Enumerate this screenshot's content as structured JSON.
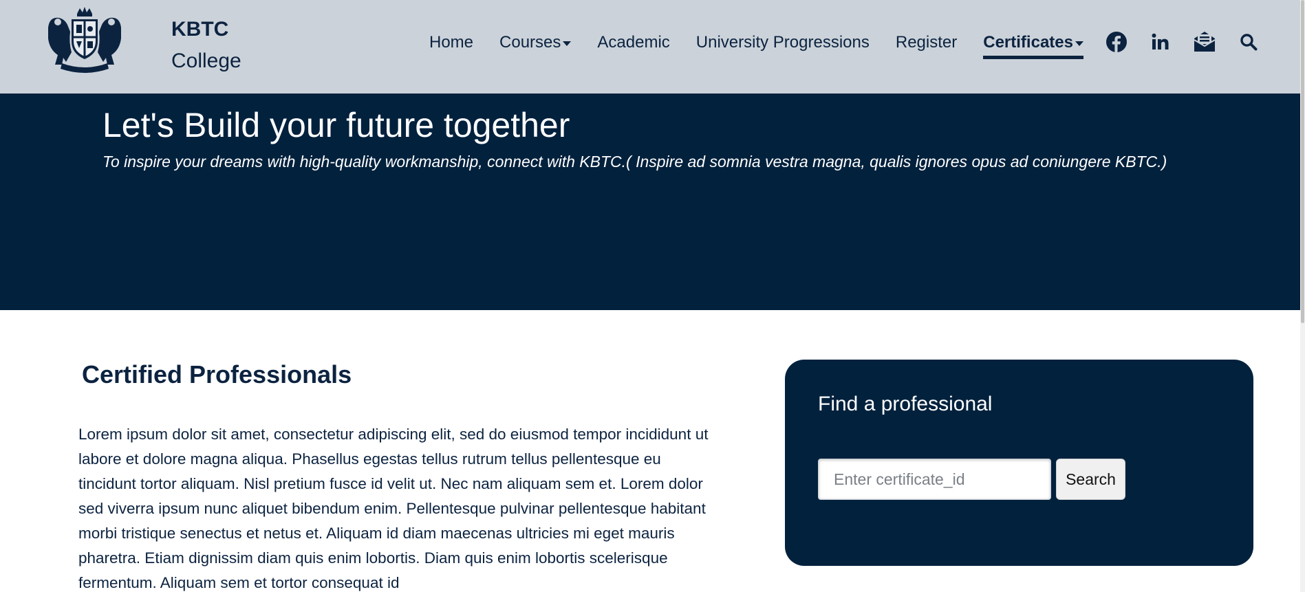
{
  "header": {
    "logo_icon": "college-crest-icon",
    "brand_title": "KBTC",
    "brand_sub": "College",
    "nav": [
      {
        "label": "Home",
        "dropdown": false,
        "active": false
      },
      {
        "label": "Courses",
        "dropdown": true,
        "active": false
      },
      {
        "label": "Academic",
        "dropdown": false,
        "active": false
      },
      {
        "label": "University Progressions",
        "dropdown": false,
        "active": false
      },
      {
        "label": "Register",
        "dropdown": false,
        "active": false
      },
      {
        "label": "Certificates",
        "dropdown": true,
        "active": true
      }
    ],
    "icons": [
      "facebook-icon",
      "linkedin-icon",
      "mail-icon",
      "search-icon"
    ]
  },
  "hero": {
    "title": "Let's Build your future together",
    "tagline": "To inspire your dreams with high-quality workmanship, connect with KBTC.( Inspire ad somnia vestra magna, qualis ignores opus ad coniungere KBTC.)"
  },
  "main": {
    "title": "Certified Professionals",
    "body": "Lorem ipsum dolor sit amet, consectetur adipiscing elit, sed do eiusmod tempor incididunt ut labore et dolore magna aliqua. Phasellus egestas tellus rutrum tellus pellentesque eu tincidunt tortor aliquam. Nisl pretium fusce id velit ut. Nec nam aliquam sem et. Lorem dolor sed viverra ipsum nunc aliquet bibendum enim. Pellentesque pulvinar pellentesque habitant morbi tristique senectus et netus et. Aliquam id diam maecenas ultricies mi eget mauris pharetra. Etiam dignissim diam quis enim lobortis. Diam quis enim lobortis scelerisque fermentum. Aliquam sem et tortor consequat id"
  },
  "find": {
    "title": "Find a professional",
    "input_placeholder": "Enter certificate_id",
    "input_value": "",
    "button_label": "Search"
  },
  "colors": {
    "navy": "#02213d",
    "header_bg": "#cbd2d9",
    "text": "#0c2340"
  }
}
